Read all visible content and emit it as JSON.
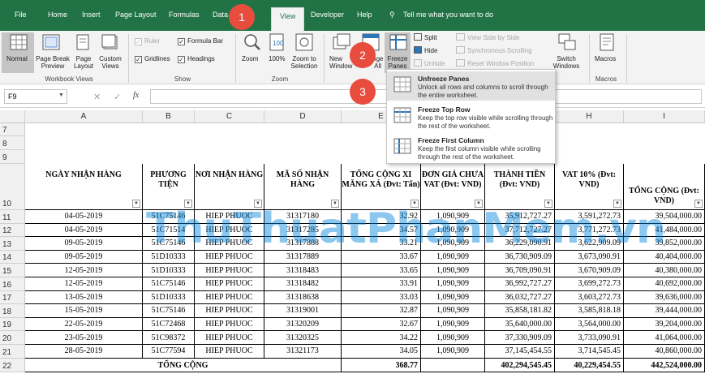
{
  "tabs": [
    "File",
    "Home",
    "Insert",
    "Page Layout",
    "Formulas",
    "Data",
    "View",
    "Developer",
    "Help"
  ],
  "tell_me": "Tell me what you want to do",
  "ribbon": {
    "workbook_views": {
      "normal": "Normal",
      "page_break": "Page Break Preview",
      "page_layout": "Page Layout",
      "custom": "Custom Views",
      "label": "Workbook Views"
    },
    "show": {
      "ruler": "Ruler",
      "formula_bar": "Formula Bar",
      "gridlines": "Gridlines",
      "headings": "Headings",
      "label": "Show"
    },
    "zoom": {
      "zoom": "Zoom",
      "pct": "100%",
      "to_selection": "Zoom to Selection",
      "label": "Zoom"
    },
    "window": {
      "new_window": "New Window",
      "arrange_all": "Arrange All",
      "freeze_panes": "Freeze Panes",
      "split": "Split",
      "hide": "Hide",
      "unhide": "Unhide",
      "side_by_side": "View Side by Side",
      "sync_scroll": "Synchronous Scrolling",
      "reset_pos": "Reset Window Position",
      "switch_windows": "Switch Windows"
    },
    "macros": {
      "macros": "Macros",
      "label": "Macros"
    }
  },
  "name_box": "F9",
  "fx": "fx",
  "freeze_menu": [
    {
      "title": "Unfreeze Panes",
      "desc": "Unlock all rows and columns to scroll through the entire worksheet."
    },
    {
      "title": "Freeze Top Row",
      "desc": "Keep the top row visible while scrolling through the rest of the worksheet."
    },
    {
      "title": "Freeze First Column",
      "desc": "Keep the first column visible while scrolling through the rest of the worksheet."
    }
  ],
  "badges": [
    "1",
    "2",
    "3"
  ],
  "columns": [
    "A",
    "B",
    "C",
    "D",
    "E",
    "F",
    "G",
    "H",
    "I"
  ],
  "headers": [
    "NGÀY NHẬN HÀNG",
    "PHƯƠNG TIỆN",
    "NƠI NHẬN HÀNG",
    "MÃ SỐ NHẬN HÀNG",
    "TỔNG CỘNG XI MĂNG XÁ (Đvt: Tấn)",
    "ĐƠN GIÁ CHƯA VAT (Đvt: VND)",
    "THÀNH TIỀN (Đvt: VND)",
    "VAT 10% (Đvt: VND)",
    "TỔNG CỘNG (Đvt: VND)"
  ],
  "rows": [
    [
      "04-05-2019",
      "51C75146",
      "HIEP PHUOC",
      "31317180",
      "32.92",
      "1,090,909",
      "35,912,727.27",
      "3,591,272.73",
      "39,504,000.00"
    ],
    [
      "04-05-2019",
      "51C71514",
      "HIEP PHUOC",
      "31317285",
      "34.57",
      "1,090,909",
      "37,712,727.27",
      "3,771,272.73",
      "41,484,000.00"
    ],
    [
      "09-05-2019",
      "51C75146",
      "HIEP PHUOC",
      "31317888",
      "33.21",
      "1,090,909",
      "36,229,090.91",
      "3,622,909.09",
      "39,852,000.00"
    ],
    [
      "09-05-2019",
      "51D10333",
      "HIEP PHUOC",
      "31317889",
      "33.67",
      "1,090,909",
      "36,730,909.09",
      "3,673,090.91",
      "40,404,000.00"
    ],
    [
      "12-05-2019",
      "51D10333",
      "HIEP PHUOC",
      "31318483",
      "33.65",
      "1,090,909",
      "36,709,090.91",
      "3,670,909.09",
      "40,380,000.00"
    ],
    [
      "12-05-2019",
      "51C75146",
      "HIEP PHUOC",
      "31318482",
      "33.91",
      "1,090,909",
      "36,992,727.27",
      "3,699,272.73",
      "40,692,000.00"
    ],
    [
      "13-05-2019",
      "51D10333",
      "HIEP PHUOC",
      "31318638",
      "33.03",
      "1,090,909",
      "36,032,727.27",
      "3,603,272.73",
      "39,636,000.00"
    ],
    [
      "15-05-2019",
      "51C75146",
      "HIEP PHUOC",
      "31319001",
      "32.87",
      "1,090,909",
      "35,858,181.82",
      "3,585,818.18",
      "39,444,000.00"
    ],
    [
      "22-05-2019",
      "51C72468",
      "HIEP PHUOC",
      "31320209",
      "32.67",
      "1,090,909",
      "35,640,000.00",
      "3,564,000.00",
      "39,204,000.00"
    ],
    [
      "23-05-2019",
      "51C98372",
      "HIEP PHUOC",
      "31320325",
      "34.22",
      "1,090,909",
      "37,330,909.09",
      "3,733,090.91",
      "41,064,000.00"
    ],
    [
      "28-05-2019",
      "51C77594",
      "HIEP PHUOC",
      "31321173",
      "34.05",
      "1,090,909",
      "37,145,454.55",
      "3,714,545.45",
      "40,860,000.00"
    ]
  ],
  "row_numbers": [
    "7",
    "8",
    "9",
    "10",
    "11",
    "12",
    "13",
    "14",
    "15",
    "16",
    "17",
    "18",
    "19",
    "20",
    "21",
    "22"
  ],
  "total": {
    "label": "TỔNG CỘNG",
    "tons": "368.77",
    "amount": "402,294,545.45",
    "vat": "40,229,454.55",
    "grand": "442,524,000.00"
  },
  "watermark": "ThuThuatPhanMem.vn"
}
